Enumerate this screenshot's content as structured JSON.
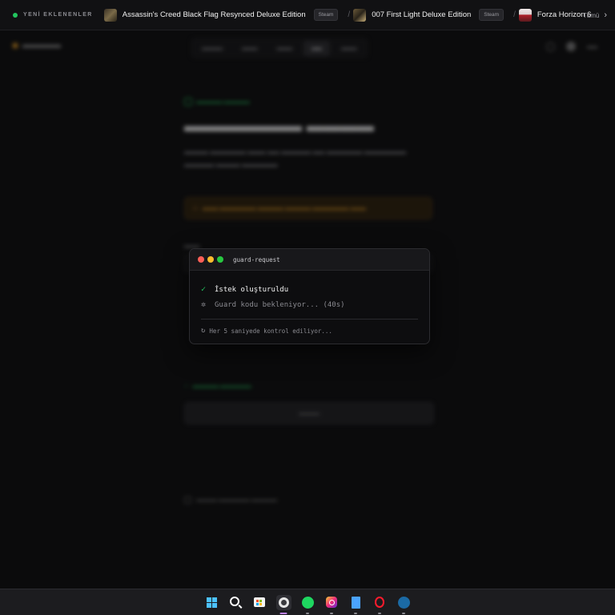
{
  "ticker": {
    "label": "YENİ EKLENENLER",
    "items": [
      {
        "title": "Assassin's Creed Black Flag Resynced Deluxe Edition",
        "badge": "Steam"
      },
      {
        "title": "007 First Light Deluxe Edition",
        "badge": "Steam"
      },
      {
        "title": "Forza Horizon 6",
        "badge": ""
      }
    ],
    "all_label": "Tümü",
    "colors": {
      "live_dot": "#22c55e"
    }
  },
  "terminal": {
    "title": "guard-request",
    "lines": [
      {
        "status": "done",
        "icon": "check-icon",
        "text": "İstek oluşturuldu"
      },
      {
        "status": "pending",
        "icon": "spinner-icon",
        "text": "Guard kodu bekleniyor... (40s)"
      }
    ],
    "footer": "Her 5 saniyede kontrol ediliyor...",
    "colors": {
      "close": "#ff5f57",
      "minimize": "#febc2e",
      "maximize": "#28c840",
      "success": "#22c55e"
    }
  },
  "taskbar": {
    "apps": [
      "start-icon",
      "search-icon",
      "store-icon",
      "obs-icon",
      "spotify-icon",
      "instagram-icon",
      "notes-icon",
      "opera-icon",
      "steam-icon"
    ],
    "active": "obs-icon"
  }
}
